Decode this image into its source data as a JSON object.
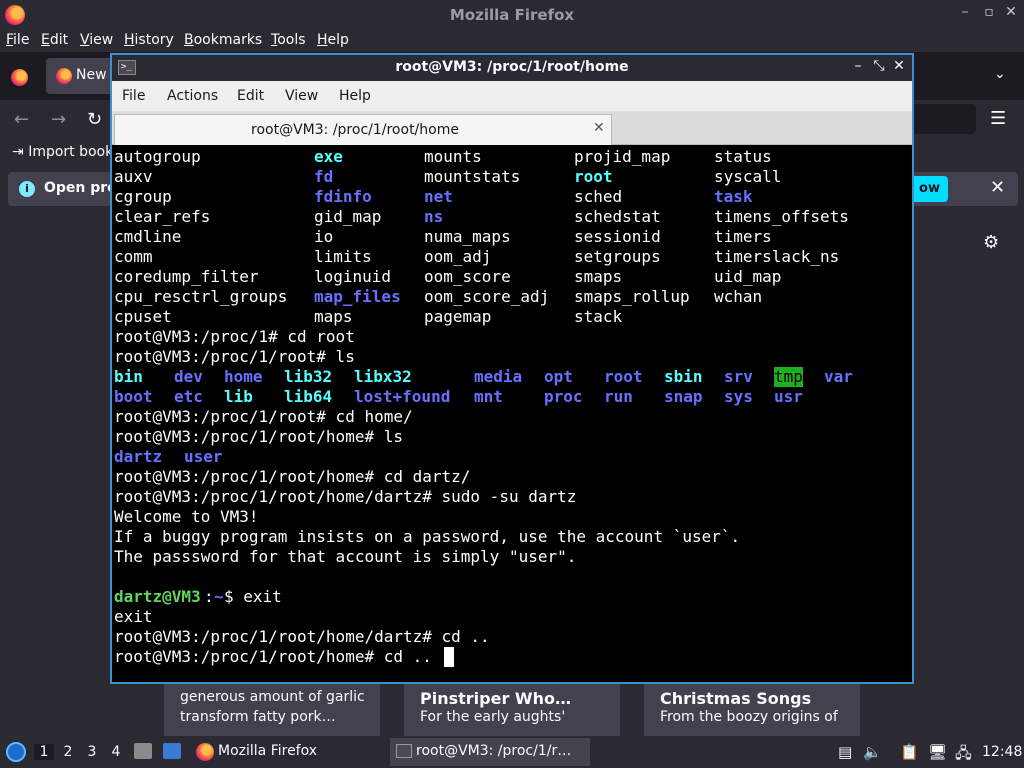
{
  "firefox": {
    "window_title": "Mozilla Firefox",
    "menu": [
      "File",
      "Edit",
      "View",
      "History",
      "Bookmarks",
      "Tools",
      "Help"
    ],
    "tab_label": "New",
    "bookmarks_import": "Import book",
    "infobar_message": "Open pre",
    "infobar_button": "ow",
    "cards": [
      {
        "line1": "generous amount of garlic",
        "line2": "transform fatty pork…"
      },
      {
        "line1": "Pinstriper Who…",
        "line2": "For the early aughts'"
      },
      {
        "line1": "Christmas Songs",
        "line2": "From the boozy origins of"
      }
    ]
  },
  "terminal": {
    "window_title": "root@VM3: /proc/1/root/home",
    "menu": [
      "File",
      "Actions",
      "Edit",
      "View",
      "Help"
    ],
    "tab_label": "root@VM3: /proc/1/root/home",
    "proc_listing": [
      [
        "autogroup",
        "exe",
        "mounts",
        "projid_map",
        "status"
      ],
      [
        "auxv",
        "fd",
        "mountstats",
        "root",
        "syscall"
      ],
      [
        "cgroup",
        "fdinfo",
        "net",
        "sched",
        "task"
      ],
      [
        "clear_refs",
        "gid_map",
        "ns",
        "schedstat",
        "timens_offsets"
      ],
      [
        "cmdline",
        "io",
        "numa_maps",
        "sessionid",
        "timers"
      ],
      [
        "comm",
        "limits",
        "oom_adj",
        "setgroups",
        "timerslack_ns"
      ],
      [
        "coredump_filter",
        "loginuid",
        "oom_score",
        "smaps",
        "uid_map"
      ],
      [
        "cpu_resctrl_groups",
        "map_files",
        "oom_score_adj",
        "smaps_rollup",
        "wchan"
      ],
      [
        "cpuset",
        "maps",
        "pagemap",
        "stack",
        ""
      ]
    ],
    "cmd1": "root@VM3:/proc/1# cd root",
    "cmd2": "root@VM3:/proc/1/root# ls",
    "root_listing": [
      [
        "bin",
        "dev",
        "home",
        "lib32",
        "libx32",
        "media",
        "opt",
        "root",
        "sbin",
        "srv",
        "tmp",
        "var"
      ],
      [
        "boot",
        "etc",
        "lib",
        "lib64",
        "lost+found",
        "mnt",
        "proc",
        "run",
        "snap",
        "sys",
        "usr"
      ]
    ],
    "cmd3": "root@VM3:/proc/1/root# cd home/",
    "cmd4": "root@VM3:/proc/1/root/home# ls",
    "home_listing": [
      "dartz",
      "user"
    ],
    "cmd5": "root@VM3:/proc/1/root/home# cd dartz/",
    "cmd6": "root@VM3:/proc/1/root/home/dartz# sudo -su dartz",
    "motd1": "Welcome to VM3!",
    "motd2": "If a buggy program insists on a password, use the account `user`.",
    "motd3": "The passsword for that account is simply \"user\".",
    "prompt_user": "dartz@VM3",
    "prompt_sep": ":",
    "prompt_path": "~",
    "prompt_cmd": "$ exit",
    "exit_out": "exit",
    "cmd7": "root@VM3:/proc/1/root/home/dartz# cd ..",
    "cmd8": "root@VM3:/proc/1/root/home# cd .."
  },
  "taskbar": {
    "workspaces": [
      "1",
      "2",
      "3",
      "4"
    ],
    "firefox_label": "Mozilla Firefox",
    "terminal_label": "root@VM3: /proc/1/r…",
    "clock": "12:48"
  }
}
